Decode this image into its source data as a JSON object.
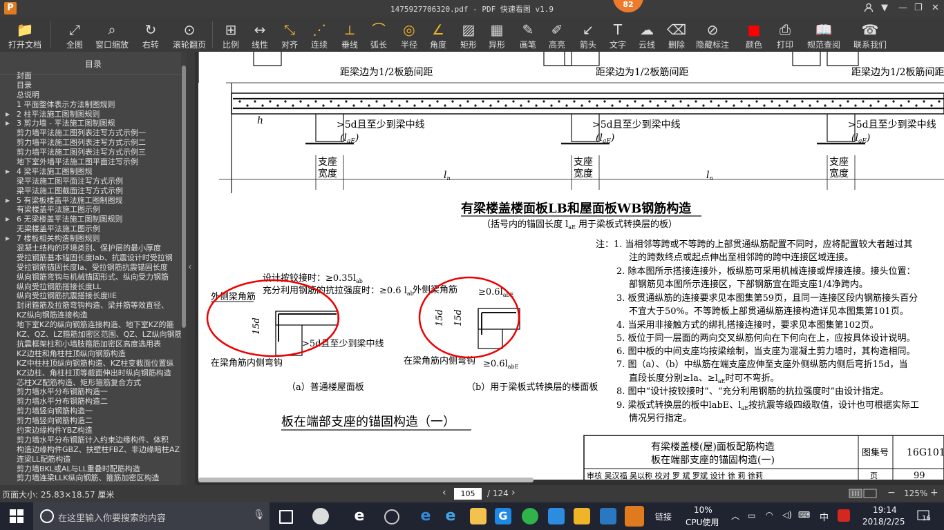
{
  "app": {
    "logo": "P",
    "title": "1475927706320.pdf - PDF 快速看图 v1.9",
    "notification_count": "82"
  },
  "toolbar": [
    {
      "label": "打开文档",
      "icon": "folder-icon"
    },
    {
      "label": "全图",
      "icon": "fit-all-icon"
    },
    {
      "label": "窗口缩放",
      "icon": "zoom-window-icon"
    },
    {
      "label": "右转",
      "icon": "rotate-right-icon"
    },
    {
      "label": "滚轮翻页",
      "icon": "mouse-wheel-icon"
    },
    {
      "label": "比例",
      "icon": "scale-icon"
    },
    {
      "label": "线性",
      "icon": "linear-dim-icon"
    },
    {
      "label": "对齐",
      "icon": "aligned-dim-icon"
    },
    {
      "label": "连续",
      "icon": "continuous-dim-icon"
    },
    {
      "label": "垂线",
      "icon": "perpendicular-icon"
    },
    {
      "label": "弧长",
      "icon": "arc-length-icon"
    },
    {
      "label": "半径",
      "icon": "radius-icon"
    },
    {
      "label": "角度",
      "icon": "angle-icon"
    },
    {
      "label": "矩形",
      "icon": "rectangle-icon"
    },
    {
      "label": "异形",
      "icon": "polygon-icon"
    },
    {
      "label": "画笔",
      "icon": "pen-icon"
    },
    {
      "label": "高亮",
      "icon": "highlighter-icon"
    },
    {
      "label": "箭头",
      "icon": "arrow-icon"
    },
    {
      "label": "文字",
      "icon": "text-icon"
    },
    {
      "label": "云线",
      "icon": "cloud-line-icon"
    },
    {
      "label": "删除",
      "icon": "eraser-icon"
    },
    {
      "label": "隐藏标注",
      "icon": "hide-annotation-icon"
    },
    {
      "label": "颜色",
      "icon": "color-icon",
      "color": "#ff0000"
    },
    {
      "label": "打印",
      "icon": "print-icon"
    },
    {
      "label": "规范查阅",
      "icon": "spec-book-icon"
    },
    {
      "label": "联系我们",
      "icon": "contact-icon"
    }
  ],
  "sidebar": {
    "title": "目录",
    "items": [
      {
        "label": "封面",
        "expandable": false
      },
      {
        "label": "目录",
        "expandable": false
      },
      {
        "label": "总说明",
        "expandable": false
      },
      {
        "label": "1 平面整体表示方法制图规则",
        "expandable": false
      },
      {
        "label": "2 柱平法施工图制图规则",
        "expandable": true
      },
      {
        "label": "3 剪力墙 - 平法施工图制图规",
        "expandable": true
      },
      {
        "label": "剪力墙平法施工图列表注写方式示例一",
        "expandable": false
      },
      {
        "label": "剪力墙平法施工图列表注写方式示例二",
        "expandable": false
      },
      {
        "label": "剪力墙平法施工图列表注写方式示例三",
        "expandable": false
      },
      {
        "label": "地下室外墙平法施工图平面注写示例",
        "expandable": false
      },
      {
        "label": "4 梁平法施工图制图规",
        "expandable": true
      },
      {
        "label": "梁平法施工图平面注写方式示例",
        "expandable": false
      },
      {
        "label": "梁平法施工图截面注写方式示例",
        "expandable": false
      },
      {
        "label": "5 有梁板楼盖平法施工图制图规",
        "expandable": true
      },
      {
        "label": "有梁楼盖平法施工图示例",
        "expandable": false
      },
      {
        "label": "6 无梁楼盖平法施工图制图规则",
        "expandable": true
      },
      {
        "label": "无梁楼盖平法施工图示例",
        "expandable": false
      },
      {
        "label": "7 楼板相关构造制图规则",
        "expandable": true
      },
      {
        "label": "混凝土结构的环境类别、保护层的最小厚度",
        "expandable": false
      },
      {
        "label": "受拉钢筋基本锚固长度lab、抗震设计时受拉钢",
        "expandable": false
      },
      {
        "label": "受拉钢筋锚固长度la、受拉钢筋抗震锚固长度",
        "expandable": false
      },
      {
        "label": "纵向钢筋弯钩与机械锚固形式、纵向受力钢筋",
        "expandable": false
      },
      {
        "label": "纵向受拉钢筋搭接长度LL",
        "expandable": false
      },
      {
        "label": "纵向受拉钢筋抗震搭接长度llE",
        "expandable": false
      },
      {
        "label": "封闭箍筋及拉筋弯钩构造、梁并筋等效直径、",
        "expandable": false
      },
      {
        "label": "KZ纵向钢筋连接构造",
        "expandable": false
      },
      {
        "label": "地下室KZ的纵向钢筋连接构造、地下室KZ的箍",
        "expandable": false
      },
      {
        "label": "KZ、QZ、LZ箍筋加密区范围、QZ、LZ纵向钢筋",
        "expandable": false
      },
      {
        "label": "抗震框架柱和小墙肢箍筋加密区高度选用表",
        "expandable": false
      },
      {
        "label": "KZ边柱和角柱柱顶纵向钢筋构造",
        "expandable": false
      },
      {
        "label": "KZ中柱柱顶纵向钢筋构造、KZ柱变截面位置纵",
        "expandable": false
      },
      {
        "label": "KZ边柱、角柱柱顶等截面伸出时纵向钢筋构造",
        "expandable": false
      },
      {
        "label": "芯柱XZ配筋构造、矩形箍筋复合方式",
        "expandable": false
      },
      {
        "label": "剪力墙水平分布钢筋构造一",
        "expandable": false
      },
      {
        "label": "剪力墙水平分布钢筋构造二",
        "expandable": false
      },
      {
        "label": "剪力墙竖向钢筋构造一",
        "expandable": false
      },
      {
        "label": "剪力墙竖向钢筋构造二",
        "expandable": false
      },
      {
        "label": "约束边缘构件YBZ构造",
        "expandable": false
      },
      {
        "label": "剪力墙水平分布钢筋计入约束边缘构件、体积",
        "expandable": false
      },
      {
        "label": "构造边缘构件GBZ、扶壁柱FBZ、非边缘暗柱AZ",
        "expandable": false
      },
      {
        "label": "连梁LL配筋构造",
        "expandable": false
      },
      {
        "label": "剪力墙BKL或AL与LL重叠时配筋构造",
        "expandable": false
      },
      {
        "label": "剪力墙连梁LLK纵向钢筋、箍筋加密区构造",
        "expandable": false
      }
    ]
  },
  "drawing": {
    "dim_note": "距梁边为1/2板筋间距",
    "lap_note": ">5d且至少到梁中线",
    "lap_note_paren": "(l",
    "lap_note_paren_sub": "aE",
    "lap_note_paren_close": ")",
    "support_label_1": "支座",
    "support_label_2": "宽度",
    "span_label": "l",
    "span_label_sub": "n",
    "h_label": "h",
    "title": "有梁楼盖楼面板LB和屋面板WB钢筋构造",
    "subtitle": "（括号内的锚固长度 l",
    "subtitle_sub": "aE",
    "subtitle_tail": " 用于梁板式转换层的板）",
    "detail_a": {
      "top_note_1": "设计按铰接时：≥0.35l",
      "top_note_1_sub": "ab",
      "top_note_2": "充分利用钢筋的抗拉强度时：≥0.6 l",
      "top_note_2_sub": "ab",
      "outer_bar": "外侧梁角筋",
      "dim": "15d",
      "lap": ">5d且至少到梁中线",
      "inner_bar": "在梁角筋内侧弯钩",
      "caption": "（a）普通楼屋面板"
    },
    "detail_b": {
      "outer_bar": "外侧梁角筋",
      "top_dim": "≥0.6l",
      "top_dim_sub": "abE",
      "dim1": "15d",
      "dim2": "15d",
      "inner_bar": "在梁角筋内侧弯钩",
      "bottom_dim": "≥0.6l",
      "bottom_dim_sub": "abE",
      "caption": "（b）用于梁板式转换层的楼面板"
    },
    "section_title": "板在端部支座的锚固构造（一）",
    "notes": [
      "注：1. 当相邻等跨或不等跨的上部贯通纵筋配置不同时，应将配置较大者越过其",
      "注的跨数终点或起点伸出至相邻跨的跨中连接区域连接。",
      "2. 除本图所示搭接连接外，板纵筋可采用机械连接或焊接连接。接头位置：",
      "部钢筋见本图所示连接区，下部钢筋宜在距支座1/4净跨内。",
      "3. 板贯通纵筋的连接要求见本图集第59页，且同一连接区段内钢筋接头百分",
      "不宜大于50%。不等跨板上部贯通纵筋连接构造详见本图集第101页。",
      "4. 当采用非接触方式的绑扎搭接连接时，要求见本图集第102页。",
      "5. 板位于同一层面的两向交叉纵筋何向在下何向在上，应按具体设计说明。",
      "6. 图中板的中间支座均按梁绘制，当支座为混凝土剪力墙时，其构造相同。",
      "7. 图（a）、（b）中纵筋在端支座应伸至支座外侧纵筋内侧后弯折15d，当",
      "直段长度分别≥l",
      "8. 图中“设计按铰接时”、“充分利用钢筋的抗拉强度时”由设计指定。",
      "9. 梁板式转换层的板中l",
      "情况另行指定。"
    ],
    "note7_tail": "a、≥l",
    "note7_tail_sub": "aE",
    "note7_end": "时可不弯折。",
    "note9_mid": "abE、l",
    "note9_mid_sub": "aE",
    "note9_end": "按抗震等级四级取值，设计也可根据实际工",
    "title_block": {
      "line1": "有梁楼盖楼(屋)面板配筋构造",
      "line2": "板在端部支座的锚固构造(一)",
      "atlas_label": "图集号",
      "atlas_no": "16G101",
      "bottom_row": "审核 吴汉福 吴以称 校对 罗 斌 罗斌 设计 徐 莉 徐莉",
      "page_label": "页",
      "page_no": "99"
    }
  },
  "statusbar": {
    "page_size": "页面大小: 25.83×18.57 厘米",
    "current_page": "105",
    "total_pages": "/ 124",
    "zoom": "125%"
  },
  "taskbar": {
    "search_placeholder": "在这里输入你要搜索的内容",
    "link_label": "链接",
    "cpu_percent": "10%",
    "cpu_label": "CPU使用",
    "ime": "中",
    "time": "19:14",
    "date": "2018/2/25",
    "notif_count": "16"
  }
}
